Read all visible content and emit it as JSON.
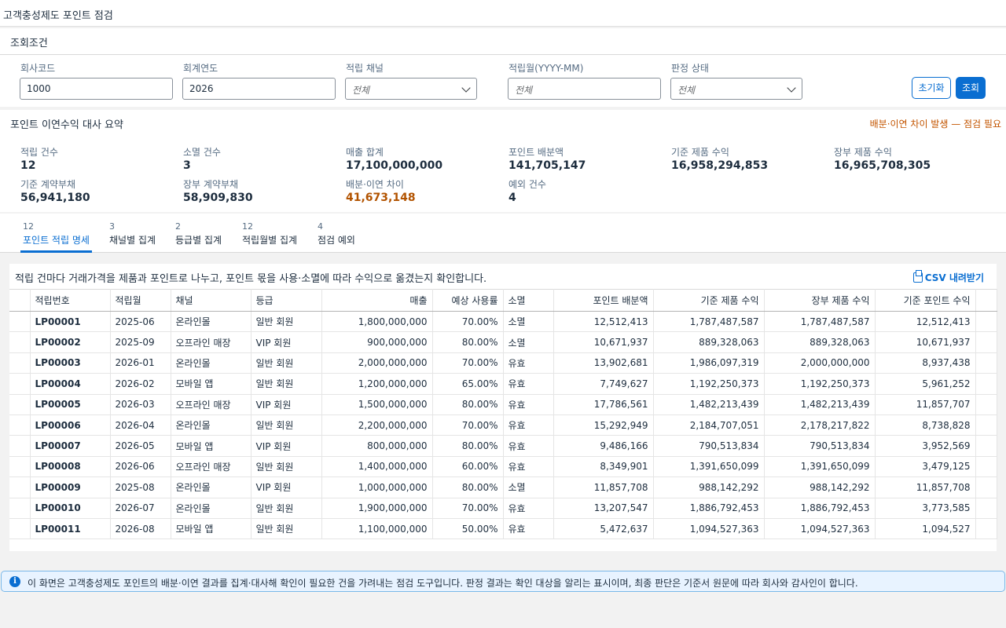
{
  "app": {
    "title": "고객충성제도 포인트 점검"
  },
  "filter": {
    "title": "조회조건",
    "company_code": {
      "label": "회사코드",
      "value": "1000"
    },
    "fiscal_year": {
      "label": "회계연도",
      "value": "2026"
    },
    "channel": {
      "label": "적립 채널",
      "value": "전체"
    },
    "accrual_month": {
      "label": "적립월(YYYY-MM)",
      "placeholder": "전체"
    },
    "status": {
      "label": "판정 상태",
      "value": "전체"
    },
    "reset_label": "초기화",
    "search_label": "조회"
  },
  "summary": {
    "title": "포인트 이연수익 대사 요약",
    "warning": "배분·이연 차이 발생 — 점검 필요",
    "kpis": [
      {
        "label": "적립 건수",
        "value": "12"
      },
      {
        "label": "소멸 건수",
        "value": "3"
      },
      {
        "label": "매출 합계",
        "value": "17,100,000,000"
      },
      {
        "label": "포인트 배분액",
        "value": "141,705,147"
      },
      {
        "label": "기준 제품 수익",
        "value": "16,958,294,853"
      },
      {
        "label": "장부 제품 수익",
        "value": "16,965,708,305"
      },
      {
        "label": "기준 계약부채",
        "value": "56,941,180"
      },
      {
        "label": "장부 계약부채",
        "value": "58,909,830"
      },
      {
        "label": "배분·이연 차이",
        "value": "41,673,148"
      },
      {
        "label": "예외 건수",
        "value": "4"
      }
    ]
  },
  "tabs": [
    {
      "count": "12",
      "label": "포인트 적립 명세"
    },
    {
      "count": "3",
      "label": "채널별 집계"
    },
    {
      "count": "2",
      "label": "등급별 집계"
    },
    {
      "count": "12",
      "label": "적립월별 집계"
    },
    {
      "count": "4",
      "label": "점검 예외"
    }
  ],
  "table": {
    "description": "적립 건마다 거래가격을 제품과 포인트로 나누고, 포인트 몫을 사용·소멸에 따라 수익으로 옮겼는지 확인합니다.",
    "csv_label": "CSV 내려받기",
    "columns": [
      "적립번호",
      "적립월",
      "채널",
      "등급",
      "매출",
      "예상 사용률",
      "소멸",
      "포인트 배분액",
      "기준 제품 수익",
      "장부 제품 수익",
      "기준 포인트 수익"
    ],
    "rows": [
      [
        "LP00001",
        "2025-06",
        "온라인몰",
        "일반 회원",
        "1,800,000,000",
        "70.00%",
        "소멸",
        "12,512,413",
        "1,787,487,587",
        "1,787,487,587",
        "12,512,413"
      ],
      [
        "LP00002",
        "2025-09",
        "오프라인 매장",
        "VIP 회원",
        "900,000,000",
        "80.00%",
        "소멸",
        "10,671,937",
        "889,328,063",
        "889,328,063",
        "10,671,937"
      ],
      [
        "LP00003",
        "2026-01",
        "온라인몰",
        "일반 회원",
        "2,000,000,000",
        "70.00%",
        "유효",
        "13,902,681",
        "1,986,097,319",
        "2,000,000,000",
        "8,937,438"
      ],
      [
        "LP00004",
        "2026-02",
        "모바일 앱",
        "일반 회원",
        "1,200,000,000",
        "65.00%",
        "유효",
        "7,749,627",
        "1,192,250,373",
        "1,192,250,373",
        "5,961,252"
      ],
      [
        "LP00005",
        "2026-03",
        "오프라인 매장",
        "VIP 회원",
        "1,500,000,000",
        "80.00%",
        "유효",
        "17,786,561",
        "1,482,213,439",
        "1,482,213,439",
        "11,857,707"
      ],
      [
        "LP00006",
        "2026-04",
        "온라인몰",
        "일반 회원",
        "2,200,000,000",
        "70.00%",
        "유효",
        "15,292,949",
        "2,184,707,051",
        "2,178,217,822",
        "8,738,828"
      ],
      [
        "LP00007",
        "2026-05",
        "모바일 앱",
        "VIP 회원",
        "800,000,000",
        "80.00%",
        "유효",
        "9,486,166",
        "790,513,834",
        "790,513,834",
        "3,952,569"
      ],
      [
        "LP00008",
        "2026-06",
        "오프라인 매장",
        "일반 회원",
        "1,400,000,000",
        "60.00%",
        "유효",
        "8,349,901",
        "1,391,650,099",
        "1,391,650,099",
        "3,479,125"
      ],
      [
        "LP00009",
        "2025-08",
        "온라인몰",
        "VIP 회원",
        "1,000,000,000",
        "80.00%",
        "소멸",
        "11,857,708",
        "988,142,292",
        "988,142,292",
        "11,857,708"
      ],
      [
        "LP00010",
        "2026-07",
        "온라인몰",
        "일반 회원",
        "1,900,000,000",
        "70.00%",
        "유효",
        "13,207,547",
        "1,886,792,453",
        "1,886,792,453",
        "3,773,585"
      ],
      [
        "LP00011",
        "2026-08",
        "모바일 앱",
        "일반 회원",
        "1,100,000,000",
        "50.00%",
        "유효",
        "5,472,637",
        "1,094,527,363",
        "1,094,527,363",
        "1,094,527"
      ]
    ]
  },
  "notice": {
    "icon": "info-icon",
    "text": "이 화면은 고객충성제도 포인트의 배분·이연 결과를 집계·대사해 확인이 필요한 건을 가려내는 점검 도구입니다. 판정 결과는 확인 대상을 알리는 표시이며, 최종 판단은 기준서 원문에 따라 회사와 감사인이 합니다."
  },
  "colors": {
    "accent": "#0a6ed1",
    "warning": "#c35500"
  }
}
